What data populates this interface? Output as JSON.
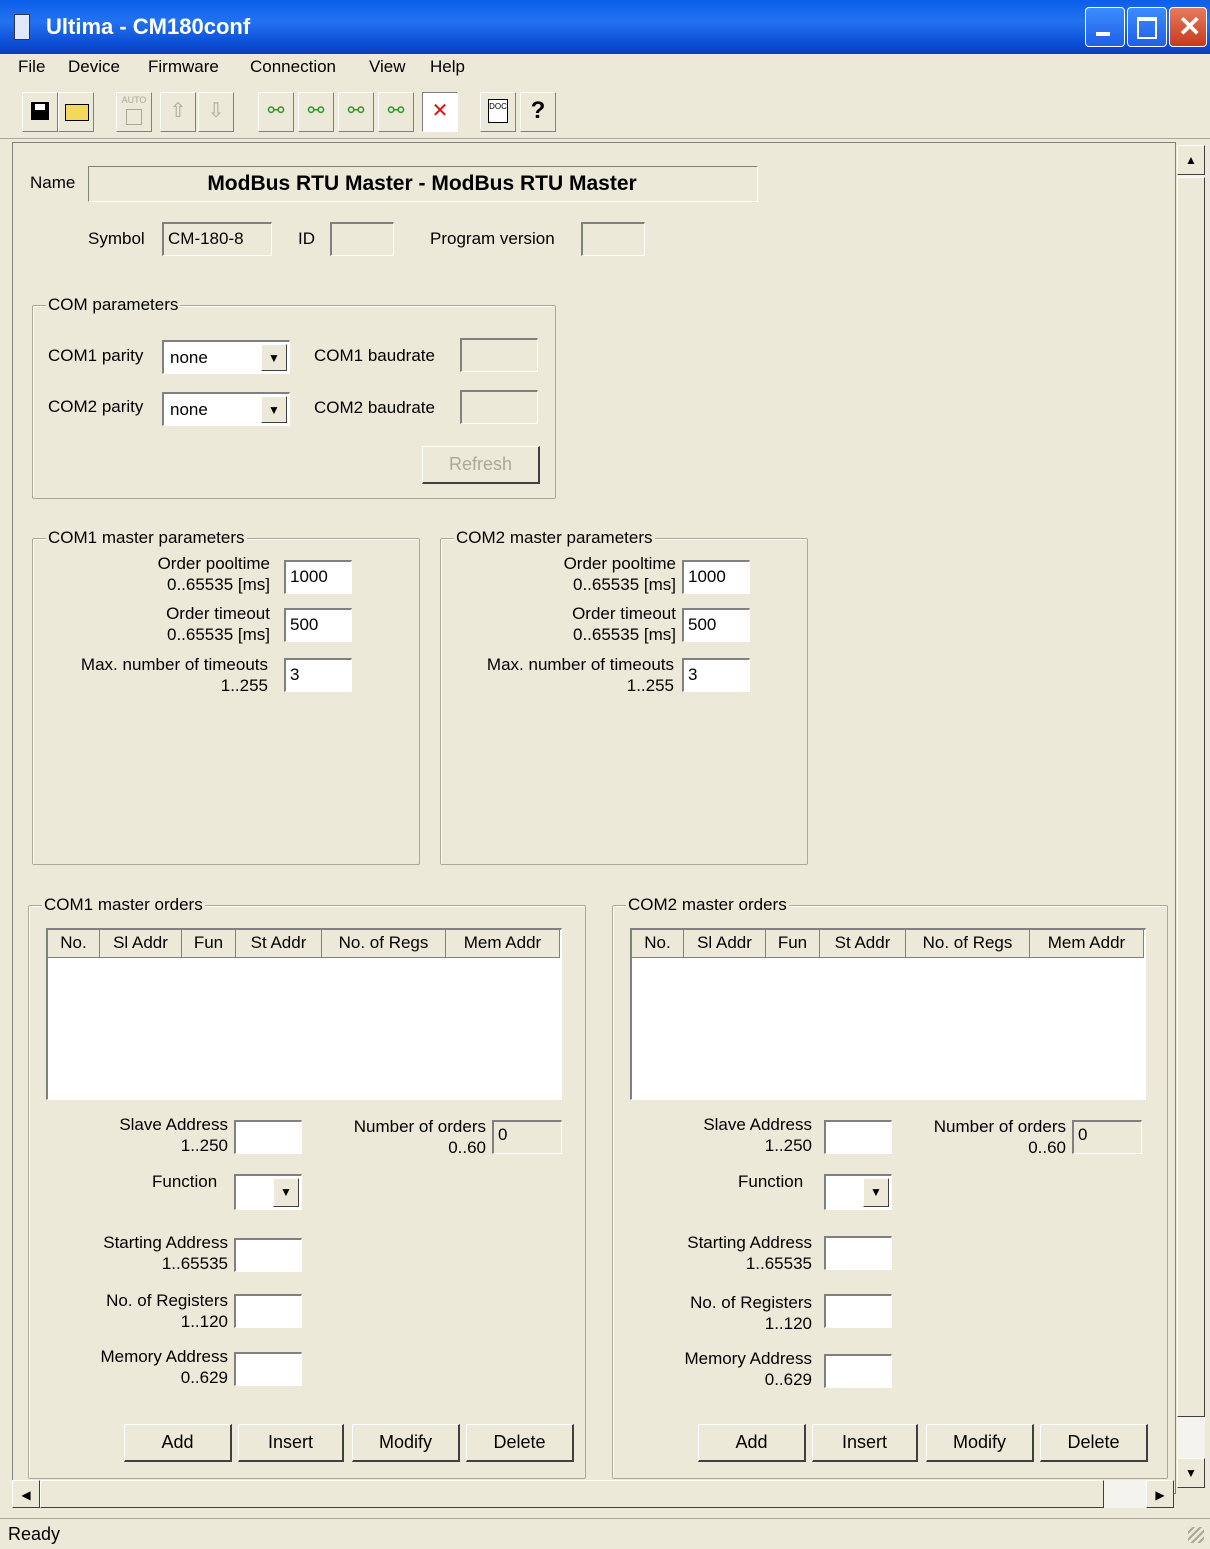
{
  "window": {
    "title": "Ultima - CM180conf"
  },
  "menu": [
    "File",
    "Device",
    "Firmware",
    "Connection",
    "View",
    "Help"
  ],
  "toolbar": {
    "save_icon": "save-icon",
    "open_icon": "open-icon",
    "auto_label": "AUTO",
    "doc_label": "DOC",
    "help_glyph": "?"
  },
  "device": {
    "name_label": "Name",
    "name_value": "ModBus RTU Master - ModBus RTU Master",
    "symbol_label": "Symbol",
    "symbol_value": "CM-180-8",
    "id_label": "ID",
    "id_value": "",
    "program_version_label": "Program version",
    "program_version_value": ""
  },
  "com_params": {
    "title": "COM parameters",
    "com1_parity_label": "COM1 parity",
    "com1_parity_value": "none",
    "com2_parity_label": "COM2 parity",
    "com2_parity_value": "none",
    "com1_baudrate_label": "COM1 baudrate",
    "com1_baudrate_value": "",
    "com2_baudrate_label": "COM2 baudrate",
    "com2_baudrate_value": "",
    "refresh_label": "Refresh"
  },
  "com1_master": {
    "title": "COM1 master parameters",
    "pooltime_label1": "Order pooltime",
    "pooltime_label2": "0..65535 [ms]",
    "pooltime_value": "1000",
    "timeout_label1": "Order timeout",
    "timeout_label2": "0..65535 [ms]",
    "timeout_value": "500",
    "maxto_label1": "Max. number of timeouts",
    "maxto_label2": "1..255",
    "maxto_value": "3"
  },
  "com2_master": {
    "title": "COM2 master parameters",
    "pooltime_label1": "Order pooltime",
    "pooltime_label2": "0..65535 [ms]",
    "pooltime_value": "1000",
    "timeout_label1": "Order timeout",
    "timeout_label2": "0..65535 [ms]",
    "timeout_value": "500",
    "maxto_label1": "Max. number of timeouts",
    "maxto_label2": "1..255",
    "maxto_value": "3"
  },
  "orders_columns": [
    "No.",
    "Sl Addr",
    "Fun",
    "St Addr",
    "No. of Regs",
    "Mem Addr"
  ],
  "com1_orders": {
    "title": "COM1 master orders",
    "slave_label1": "Slave Address",
    "slave_label2": "1..250",
    "slave_value": "",
    "count_label1": "Number of orders",
    "count_label2": "0..60",
    "count_value": "0",
    "function_label": "Function",
    "function_value": "",
    "start_label1": "Starting Address",
    "start_label2": "1..65535",
    "start_value": "",
    "regs_label1": "No. of Registers",
    "regs_label2": "1..120",
    "regs_value": "",
    "mem_label1": "Memory Address",
    "mem_label2": "0..629",
    "mem_value": "",
    "add": "Add",
    "insert": "Insert",
    "modify": "Modify",
    "delete": "Delete"
  },
  "com2_orders": {
    "title": "COM2 master orders",
    "slave_label1": "Slave Address",
    "slave_label2": "1..250",
    "slave_value": "",
    "count_label1": "Number of orders",
    "count_label2": "0..60",
    "count_value": "0",
    "function_label": "Function",
    "function_value": "",
    "start_label1": "Starting Address",
    "start_label2": "1..65535",
    "start_value": "",
    "regs_label1": "No. of Registers",
    "regs_label2": "1..120",
    "regs_value": "",
    "mem_label1": "Memory Address",
    "mem_label2": "0..629",
    "mem_value": "",
    "add": "Add",
    "insert": "Insert",
    "modify": "Modify",
    "delete": "Delete"
  },
  "status": {
    "text": "Ready"
  }
}
